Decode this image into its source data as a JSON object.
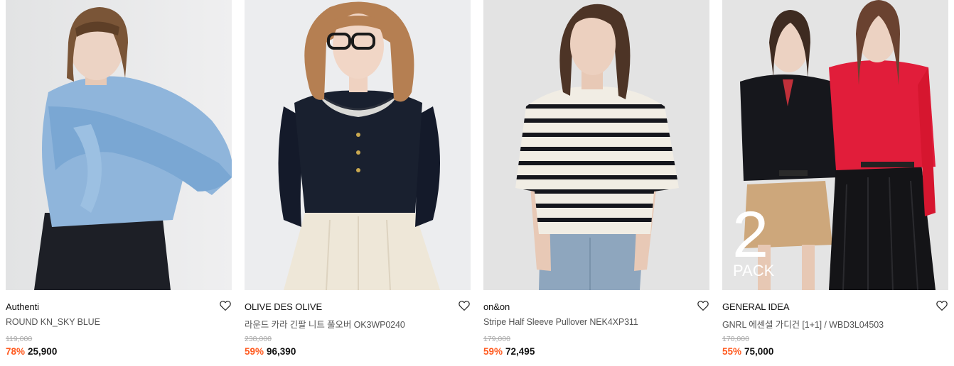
{
  "products": [
    {
      "brand": "Authenti",
      "name": "ROUND KN_SKY BLUE",
      "original_price": "119,000",
      "discount": "78%",
      "sale_price": "25,900",
      "wishlist_icon": "heart-outline-icon"
    },
    {
      "brand": "OLIVE DES OLIVE",
      "name": "라운드 카라 긴팔 니트 풀오버 OK3WP0240",
      "original_price": "238,000",
      "discount": "59%",
      "sale_price": "96,390",
      "wishlist_icon": "heart-outline-icon"
    },
    {
      "brand": "on&on",
      "name": "Stripe Half Sleeve Pullover NEK4XP311",
      "original_price": "179,000",
      "discount": "59%",
      "sale_price": "72,495",
      "wishlist_icon": "heart-outline-icon"
    },
    {
      "brand": "GENERAL IDEA",
      "name": "GNRL 에센셜 가디건 [1+1] / WBD3L04503",
      "original_price": "170,000",
      "discount": "55%",
      "sale_price": "75,000",
      "wishlist_icon": "heart-outline-icon",
      "badge_number": "2",
      "badge_text": "PACK"
    }
  ],
  "colors": {
    "discount": "#ff5a1f",
    "original_price": "#aaaaaa",
    "name": "#555555"
  }
}
